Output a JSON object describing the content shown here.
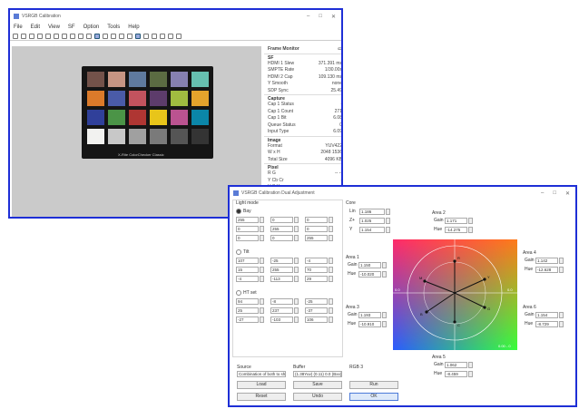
{
  "main_window": {
    "title": "VSRGB Calibration",
    "controls": {
      "min": "–",
      "max": "□",
      "close": "✕"
    },
    "menu": [
      "File",
      "Edit",
      "View",
      "SF",
      "Option",
      "Tools",
      "Help"
    ],
    "panel": {
      "header": "Frame Monitor",
      "sections": [
        {
          "title": "SF",
          "rows": [
            [
              "HDMI 1 Slew",
              "371.391 ms"
            ],
            [
              "SMPTE Rate",
              "1/30.00s"
            ],
            [
              "HDMI 2 Cap",
              "109.130 ms"
            ],
            [
              "Y Smooth",
              "none"
            ],
            [
              "SDP Sync",
              "25.49"
            ]
          ]
        },
        {
          "title": "Capture",
          "rows": [
            [
              "Cap 1 Status",
              "-"
            ],
            [
              "Cap 1 Count",
              "271"
            ],
            [
              "Cap 1 Bit",
              "6.08"
            ],
            [
              "Queue Status",
              "0"
            ],
            [
              "Input Type",
              "6.09"
            ]
          ]
        },
        {
          "title": "Image",
          "rows": [
            [
              "Format",
              "YUV422"
            ],
            [
              "W x H",
              "2048 1536"
            ],
            [
              "Total Size",
              "4096 KB"
            ]
          ]
        },
        {
          "title": "Pixel",
          "rows": [
            [
              "R G",
              "--  --"
            ],
            [
              "Y Cb Cr",
              "-"
            ],
            [
              "H S V",
              "-- -- --"
            ]
          ]
        }
      ]
    },
    "checker_label": "X-Rite ColorChecker Classic",
    "swatches": [
      "#73524a",
      "#c69583",
      "#5f7a9e",
      "#5b6b42",
      "#8680b0",
      "#66bfb0",
      "#db7a2a",
      "#4a5ba8",
      "#c2535e",
      "#5d3c6b",
      "#a0bc40",
      "#e4a32c",
      "#30409a",
      "#4b9447",
      "#af3633",
      "#e8c51a",
      "#bb5390",
      "#0b86a8",
      "#f2f2f0",
      "#c8c8c8",
      "#a0a0a0",
      "#7a7a7a",
      "#555555",
      "#343434"
    ]
  },
  "dialog": {
    "title": "VSRGB Calibration Dual Adjustment",
    "controls": {
      "min": "–",
      "max": "□",
      "close": "✕"
    },
    "left_group_title": "Light mode",
    "options": [
      "Bay",
      "Tilt",
      "HT set"
    ],
    "grid1": [
      [
        "255",
        "0",
        "0"
      ],
      [
        "0",
        "255",
        "0"
      ],
      [
        "0",
        "0",
        "255"
      ]
    ],
    "grid2": [
      [
        "107",
        "-25",
        "-4"
      ],
      [
        "15",
        "255",
        "70"
      ],
      [
        "-4",
        "-113",
        "29"
      ]
    ],
    "grid3": [
      [
        "94",
        "-8",
        "-25"
      ],
      [
        "25",
        "237",
        "-37"
      ],
      [
        "-27",
        "-103",
        "106"
      ]
    ],
    "core": {
      "title": "Core",
      "rows": [
        [
          "Lin",
          "1.186"
        ],
        [
          "Z+",
          "1.025"
        ],
        [
          "Y",
          "1.154"
        ]
      ]
    },
    "area1": {
      "title": "Area 1",
      "gain_label": "Gain",
      "gain": "1.150",
      "hue_label": "Hue",
      "hue": "-10.020"
    },
    "area2": {
      "title": "Area 2",
      "gain_label": "Gain",
      "gain": "1.171",
      "hue_label": "Hue",
      "hue": "-14.275"
    },
    "area3": {
      "title": "Area 3",
      "gain_label": "Gain",
      "gain": "1.193",
      "hue_label": "Hue",
      "hue": "-10.910"
    },
    "area4": {
      "title": "Area 4",
      "gain_label": "Gain",
      "gain": "1.142",
      "hue_label": "Hue",
      "hue": "-12.628"
    },
    "area5": {
      "title": "Area 5",
      "gain_label": "Gain",
      "gain": "1.062",
      "hue_label": "Hue",
      "hue": "-8.459"
    },
    "area6": {
      "title": "Area 6",
      "gain_label": "Gain",
      "gain": "1.154",
      "hue_label": "Hue",
      "hue": "-8.729"
    },
    "wheel_markers": [
      "R",
      "Y",
      "G",
      "C",
      "B",
      "M"
    ],
    "wheel_corner": "0.00 - 0",
    "wheel_axis_left": "0.0",
    "wheel_axis_right": "0.0",
    "source": {
      "label": "Source",
      "value": "Combination of both to show"
    },
    "buffer": {
      "label": "Buffer",
      "value": "(1.38Yuv) (0.11) 0.0 (Bxx)"
    },
    "rgb": {
      "label": "RGB 3"
    },
    "buttons": {
      "load": "Load",
      "save": "Save",
      "reset": "Reset",
      "undo": "Undo",
      "run": "Run",
      "apply": "OK"
    }
  }
}
